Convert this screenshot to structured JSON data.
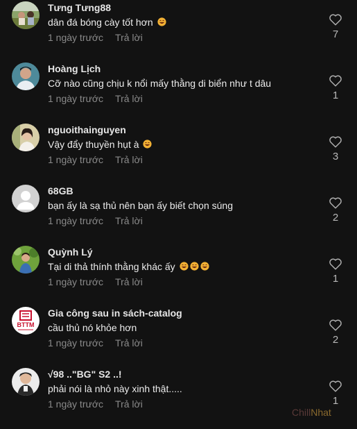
{
  "comments": [
    {
      "username": "Tưng Tưng88",
      "text": "dân đá bóng cày tốt hơn",
      "emoji_count": 1,
      "time": "1 ngày trước",
      "reply_label": "Trả lời",
      "likes": "7",
      "avatar": "photo-outdoor"
    },
    {
      "username": "Hoàng Lịch",
      "text": "Cỡ nào cũng chịu k nổi mấy thằng di biển như t dâu",
      "emoji_count": 0,
      "time": "1 ngày trước",
      "reply_label": "Trả lời",
      "likes": "1",
      "avatar": "photo-portrait"
    },
    {
      "username": "nguoithainguyen",
      "text": "Vậy đẩy thuyền hụt à",
      "emoji_count": 1,
      "time": "1 ngày trước",
      "reply_label": "Trả lời",
      "likes": "3",
      "avatar": "photo-girl"
    },
    {
      "username": "68GB",
      "text": "bạn ấy là sạ thủ nên bạn ấy biết chọn súng",
      "emoji_count": 0,
      "time": "1 ngày trước",
      "reply_label": "Trả lời",
      "likes": "2",
      "avatar": "default-avatar"
    },
    {
      "username": "Quỳnh Lý",
      "text": "Tại di thả thính thằng khác ấy",
      "emoji_count": 3,
      "time": "1 ngày trước",
      "reply_label": "Trả lời",
      "likes": "1",
      "avatar": "photo-green"
    },
    {
      "username": "Gia công sau in sách-catalog",
      "text": "cầu thủ nó khỏe hơn",
      "emoji_count": 0,
      "time": "1 ngày trước",
      "reply_label": "Trả lời",
      "likes": "2",
      "avatar": "logo-bttm",
      "avatar_text": "BTTM"
    },
    {
      "username": "√98 ..\"BG\" S2 ..!",
      "text": "phải nói là nhỏ này xinh thật.....",
      "emoji_count": 0,
      "time": "1 ngày trước",
      "reply_label": "Trả lời",
      "likes": "1",
      "avatar": "photo-cartoon"
    }
  ],
  "icons": {
    "like": "heart-outline-icon",
    "emoji": "grinning-sweat-emoji"
  },
  "watermark": {
    "part1": "Chill",
    "part2": "Nhat"
  },
  "colors": {
    "background": "#121212",
    "emoji": "#f2b134"
  }
}
